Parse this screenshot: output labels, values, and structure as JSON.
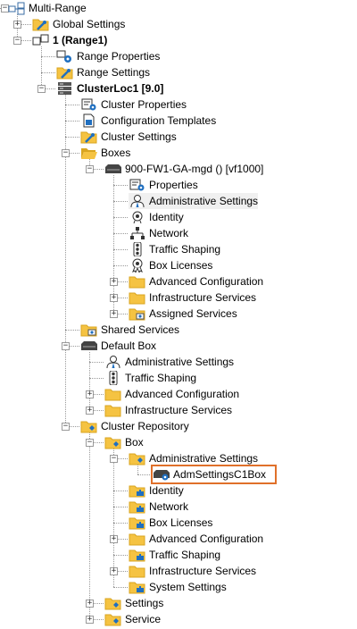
{
  "tree": {
    "root": {
      "label": "Multi-Range",
      "icon": "multi-range-icon"
    },
    "global_settings": {
      "label": "Global Settings",
      "icon": "folder-settings-icon"
    },
    "range1": {
      "label": "1 (Range1)",
      "icon": "range-icon"
    },
    "range_properties": {
      "label": "Range Properties",
      "icon": "range-properties-icon"
    },
    "range_settings": {
      "label": "Range Settings",
      "icon": "folder-settings-icon"
    },
    "cluster": {
      "label": "ClusterLoc1 [9.0]",
      "icon": "cluster-icon"
    },
    "cluster_properties": {
      "label": "Cluster Properties",
      "icon": "properties-icon"
    },
    "config_templates": {
      "label": "Configuration Templates",
      "icon": "templates-icon"
    },
    "cluster_settings": {
      "label": "Cluster Settings",
      "icon": "folder-settings-icon"
    },
    "boxes": {
      "label": "Boxes",
      "icon": "folder-open-icon"
    },
    "box1": {
      "label": "900-FW1-GA-mgd () [vf1000]",
      "icon": "firewall-box-icon"
    },
    "box1_children": [
      {
        "label": "Properties",
        "icon": "properties-icon"
      },
      {
        "label": "Administrative Settings",
        "icon": "admin-user-icon"
      },
      {
        "label": "Identity",
        "icon": "identity-icon"
      },
      {
        "label": "Network",
        "icon": "network-icon"
      },
      {
        "label": "Traffic Shaping",
        "icon": "traffic-light-icon"
      },
      {
        "label": "Box Licenses",
        "icon": "license-icon"
      },
      {
        "label": "Advanced Configuration",
        "icon": "folder-icon"
      },
      {
        "label": "Infrastructure Services",
        "icon": "folder-icon"
      },
      {
        "label": "Assigned Services",
        "icon": "folder-services-icon"
      }
    ],
    "shared_services": {
      "label": "Shared Services",
      "icon": "folder-services-icon"
    },
    "default_box": {
      "label": "Default Box",
      "icon": "box-icon"
    },
    "default_box_children": [
      {
        "label": "Administrative Settings",
        "icon": "admin-user-icon"
      },
      {
        "label": "Traffic Shaping",
        "icon": "traffic-light-icon"
      },
      {
        "label": "Advanced Configuration",
        "icon": "folder-icon"
      },
      {
        "label": "Infrastructure Services",
        "icon": "folder-icon"
      }
    ],
    "cluster_repository": {
      "label": "Cluster Repository",
      "icon": "folder-repository-icon"
    },
    "repo_box": {
      "label": "Box",
      "icon": "folder-repository-icon"
    },
    "repo_admin_settings": {
      "label": "Administrative Settings",
      "icon": "folder-repository-icon"
    },
    "adm_settings_c1box": {
      "label": "AdmSettingsC1Box",
      "icon": "repository-object-icon"
    },
    "repo_box_children": [
      {
        "label": "Identity",
        "icon": "folder-puzzle-icon"
      },
      {
        "label": "Network",
        "icon": "folder-puzzle-icon"
      },
      {
        "label": "Box Licenses",
        "icon": "folder-puzzle-icon"
      },
      {
        "label": "Advanced Configuration",
        "icon": "folder-icon"
      },
      {
        "label": "Traffic Shaping",
        "icon": "folder-puzzle-icon"
      },
      {
        "label": "Infrastructure Services",
        "icon": "folder-icon"
      },
      {
        "label": "System Settings",
        "icon": "folder-puzzle-icon"
      }
    ],
    "repo_settings": {
      "label": "Settings",
      "icon": "folder-repository-icon"
    },
    "repo_service": {
      "label": "Service",
      "icon": "folder-repository-icon"
    }
  },
  "colors": {
    "folder": "#f5c342",
    "folder_dark": "#d9a520",
    "accent_blue": "#1f6fc0",
    "highlight_border": "#e0702a",
    "tree_line": "#9a9a9a"
  }
}
